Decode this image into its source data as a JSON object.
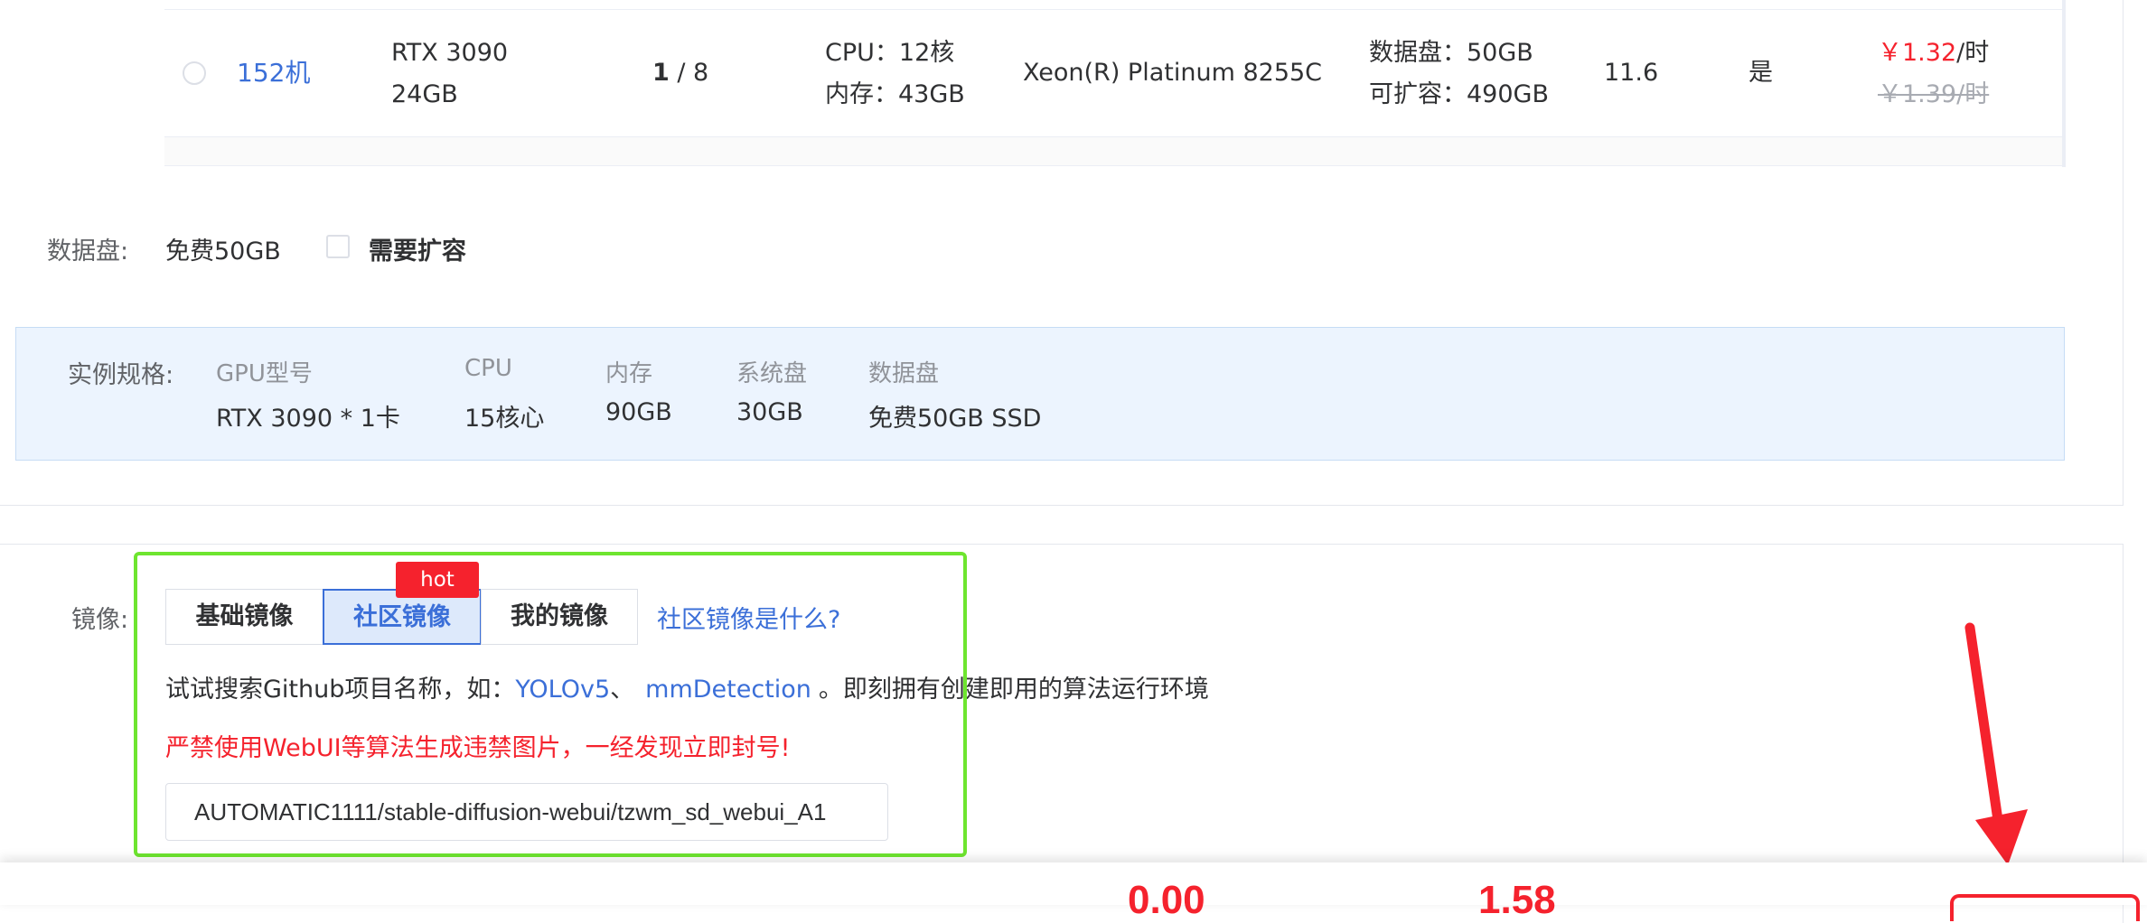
{
  "table_row": {
    "machine": "152机",
    "gpu_line1": "RTX 3090",
    "gpu_line2": "24GB",
    "gpu_free": "1",
    "gpu_total": " / 8",
    "cpu_line": "CPU：12核",
    "mem_line": "内存：43GB",
    "cpu_model": "Xeon(R) Platinum 8255C",
    "disk_line1": "数据盘：50GB",
    "disk_line2": "可扩容：490GB",
    "cuda": "11.6",
    "available": "是",
    "price_now": "￥1.32",
    "price_unit": "/时",
    "price_old": "￥1.39/时"
  },
  "data_disk": {
    "label": "数据盘:",
    "value": "免费50GB",
    "expand_label": "需要扩容"
  },
  "spec": {
    "label": "实例规格:",
    "headers": [
      "GPU型号",
      "CPU",
      "内存",
      "系统盘",
      "数据盘"
    ],
    "values": [
      "RTX 3090 * 1卡",
      "15核心",
      "90GB",
      "30GB",
      "免费50GB SSD"
    ]
  },
  "mirror": {
    "label": "镜像:",
    "tabs": [
      "基础镜像",
      "社区镜像",
      "我的镜像"
    ],
    "active_tab": "社区镜像",
    "hot_badge": "hot",
    "help_link": "社区镜像是什么?",
    "hint_prefix": "试试搜索Github项目名称，如：",
    "hint_link1": "YOLOv5",
    "hint_sep": "、",
    "hint_link2": "mmDetection",
    "hint_suffix": "。即刻拥有创建即用的算法运行环境",
    "warning": "严禁使用WebUI等算法生成违禁图片，一经发现立即封号!",
    "input_value": "AUTOMATIC1111/stable-diffusion-webui/tzwm_sd_webui_A1"
  },
  "footer": {
    "amount1": "0.00",
    "amount2": "1.58"
  },
  "colors": {
    "link": "#3b6fd8",
    "danger": "#f5222d",
    "highlight_green": "#6ee52f",
    "spec_bg": "#ecf4fe"
  }
}
